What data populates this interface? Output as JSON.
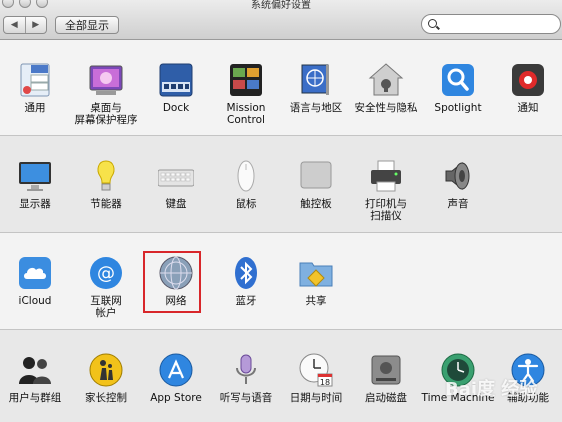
{
  "window": {
    "title": "系统偏好设置"
  },
  "toolbar": {
    "back": "◀",
    "forward": "▶",
    "show_all": "全部显示",
    "search_placeholder": ""
  },
  "sections": [
    {
      "items": [
        {
          "label": "通用",
          "icon": "general-icon"
        },
        {
          "label": "桌面与\n屏幕保护程序",
          "icon": "desktop-screensaver-icon"
        },
        {
          "label": "Dock",
          "icon": "dock-icon"
        },
        {
          "label": "Mission\nControl",
          "icon": "mission-control-icon"
        },
        {
          "label": "语言与地区",
          "icon": "language-region-icon"
        },
        {
          "label": "安全性与隐私",
          "icon": "security-privacy-icon"
        },
        {
          "label": "Spotlight",
          "icon": "spotlight-icon"
        },
        {
          "label": "通知",
          "icon": "notifications-icon"
        }
      ]
    },
    {
      "items": [
        {
          "label": "显示器",
          "icon": "displays-icon"
        },
        {
          "label": "节能器",
          "icon": "energy-saver-icon"
        },
        {
          "label": "键盘",
          "icon": "keyboard-icon"
        },
        {
          "label": "鼠标",
          "icon": "mouse-icon"
        },
        {
          "label": "触控板",
          "icon": "trackpad-icon"
        },
        {
          "label": "打印机与\n扫描仪",
          "icon": "printers-scanners-icon"
        },
        {
          "label": "声音",
          "icon": "sound-icon"
        }
      ]
    },
    {
      "items": [
        {
          "label": "iCloud",
          "icon": "icloud-icon"
        },
        {
          "label": "互联网\n帐户",
          "icon": "internet-accounts-icon"
        },
        {
          "label": "网络",
          "icon": "network-icon"
        },
        {
          "label": "蓝牙",
          "icon": "bluetooth-icon"
        },
        {
          "label": "共享",
          "icon": "sharing-icon"
        }
      ]
    },
    {
      "items": [
        {
          "label": "用户与群组",
          "icon": "users-groups-icon"
        },
        {
          "label": "家长控制",
          "icon": "parental-controls-icon"
        },
        {
          "label": "App Store",
          "icon": "app-store-icon"
        },
        {
          "label": "听写与语音",
          "icon": "dictation-speech-icon"
        },
        {
          "label": "日期与时间",
          "icon": "date-time-icon"
        },
        {
          "label": "启动磁盘",
          "icon": "startup-disk-icon"
        },
        {
          "label": "Time Machine",
          "icon": "time-machine-icon"
        },
        {
          "label": "辅助功能",
          "icon": "accessibility-icon"
        }
      ]
    }
  ],
  "date_icon_number": "18",
  "watermark": "Bai度 经验"
}
